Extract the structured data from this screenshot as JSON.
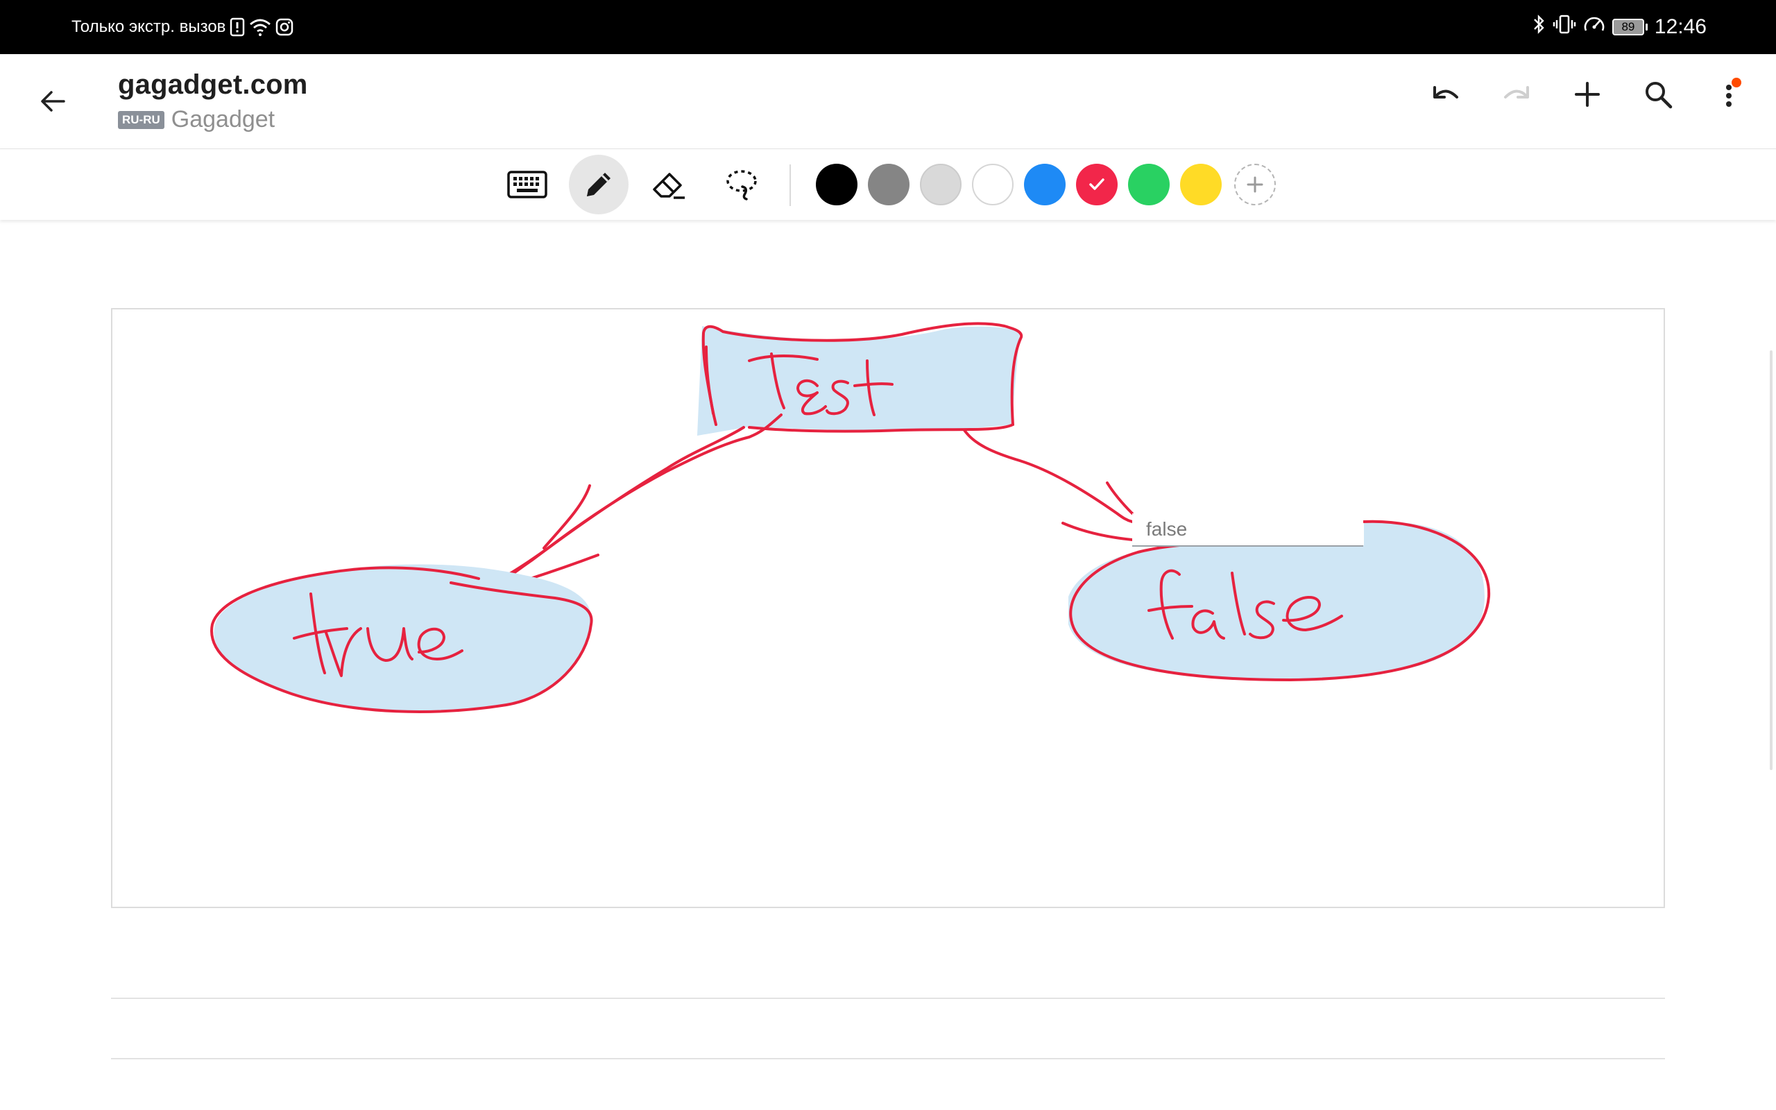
{
  "status_bar": {
    "carrier_text": "Только экстр. вызов",
    "battery_level": "89",
    "time": "12:46",
    "icons": [
      "sim-alert-icon",
      "wifi-icon",
      "instagram-icon",
      "bluetooth-icon",
      "vibrate-icon",
      "speed-icon",
      "battery-icon"
    ]
  },
  "app_bar": {
    "title": "gagadget.com",
    "language_badge": "RU-RU",
    "notebook": "Gagadget",
    "actions": [
      "undo-icon",
      "redo-icon",
      "add-icon",
      "search-icon",
      "more-icon"
    ],
    "redo_enabled": false,
    "has_notification": true
  },
  "toolbar": {
    "tools": [
      "keyboard-icon",
      "pen-icon",
      "eraser-icon",
      "lasso-icon"
    ],
    "active_tool": "pen",
    "colors": [
      {
        "name": "black",
        "hex": "#000000"
      },
      {
        "name": "gray",
        "hex": "#858585"
      },
      {
        "name": "light-gray",
        "hex": "#d9d9d9"
      },
      {
        "name": "white",
        "hex": "#ffffff"
      },
      {
        "name": "blue",
        "hex": "#1e8af5"
      },
      {
        "name": "red",
        "hex": "#f2264a"
      },
      {
        "name": "green",
        "hex": "#29d162"
      },
      {
        "name": "yellow",
        "hex": "#ffdb26"
      }
    ],
    "selected_color": "red"
  },
  "canvas": {
    "ink_color": "#e6223f",
    "fill_color": "#cfe6f5",
    "handwritten_words": [
      "Test",
      "true",
      "false"
    ],
    "text_box_value": "false"
  }
}
